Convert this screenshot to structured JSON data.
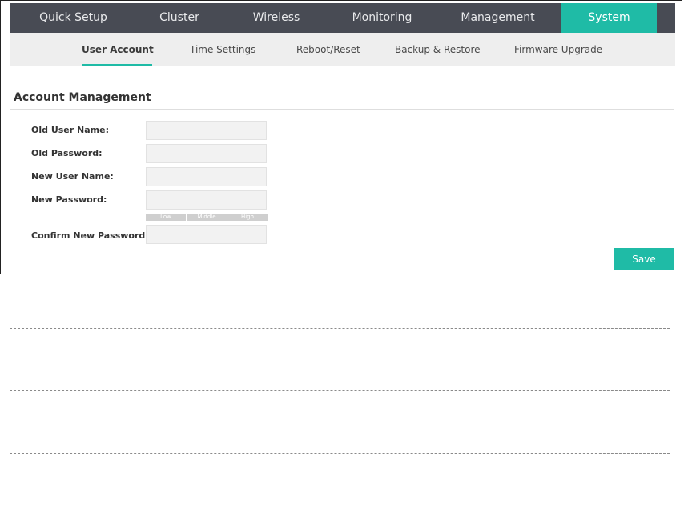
{
  "top_nav": [
    {
      "label": "Quick Setup",
      "active": false
    },
    {
      "label": "Cluster",
      "active": false
    },
    {
      "label": "Wireless",
      "active": false
    },
    {
      "label": "Monitoring",
      "active": false
    },
    {
      "label": "Management",
      "active": false
    },
    {
      "label": "System",
      "active": true
    }
  ],
  "sub_nav": [
    {
      "label": "User Account",
      "active": true
    },
    {
      "label": "Time Settings",
      "active": false
    },
    {
      "label": "Reboot/Reset",
      "active": false
    },
    {
      "label": "Backup & Restore",
      "active": false
    },
    {
      "label": "Firmware Upgrade",
      "active": false
    }
  ],
  "section": {
    "title": "Account Management"
  },
  "form": {
    "old_user_name": {
      "label": "Old User Name:",
      "value": ""
    },
    "old_password": {
      "label": "Old Password:",
      "value": ""
    },
    "new_user_name": {
      "label": "New User Name:",
      "value": ""
    },
    "new_password": {
      "label": "New Password:",
      "value": ""
    },
    "confirm_password": {
      "label": "Confirm New Password:",
      "value": ""
    },
    "strength": {
      "low": "Low",
      "middle": "Middle",
      "high": "High"
    }
  },
  "actions": {
    "save_label": "Save"
  },
  "colors": {
    "accent": "#1fbba6",
    "nav_bg": "#484b54",
    "subnav_bg": "#eeeeee"
  }
}
